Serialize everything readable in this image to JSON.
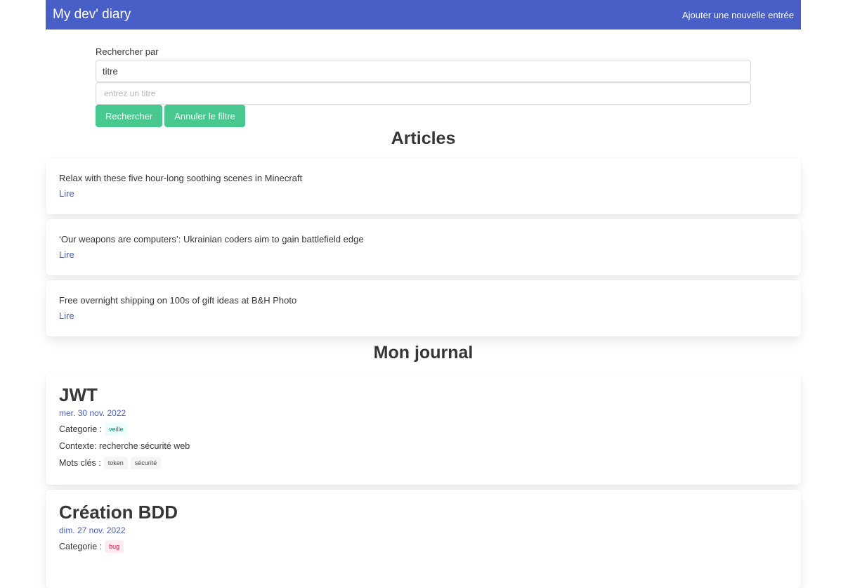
{
  "navbar": {
    "brand": "My dev' diary",
    "add_entry_link": "Ajouter une nouvelle entrée"
  },
  "search": {
    "label": "Rechercher par",
    "criteria_selected": "titre",
    "query_placeholder": "entrez un titre",
    "search_button": "Rechercher",
    "reset_button": "Annuler le filtre"
  },
  "articles": {
    "heading": "Articles",
    "items": [
      {
        "title": "Relax with these five hour-long soothing scenes in Minecraft",
        "link": "Lire"
      },
      {
        "title": "‘Our weapons are computers’: Ukrainian coders aim to gain battlefield edge",
        "link": "Lire"
      },
      {
        "title": "Free overnight shipping on 100s of gift ideas at B&H Photo",
        "link": "Lire"
      }
    ]
  },
  "journal": {
    "heading": "Mon journal",
    "entries": [
      {
        "title": "JWT",
        "date": "mer. 30 nov. 2022",
        "category_label": "Categorie :",
        "category": "veille",
        "context": "Contexte: recherche sécurité web",
        "keywords_label": "Mots clés :",
        "keywords": [
          "token",
          "sécurité"
        ]
      },
      {
        "title": "Création BDD",
        "date": "dim. 27 nov. 2022",
        "category_label": "Categorie :",
        "category": "bug"
      }
    ]
  },
  "colors": {
    "navbar": "#485fc7",
    "button": "#48c78e",
    "link": "#485fc7"
  }
}
